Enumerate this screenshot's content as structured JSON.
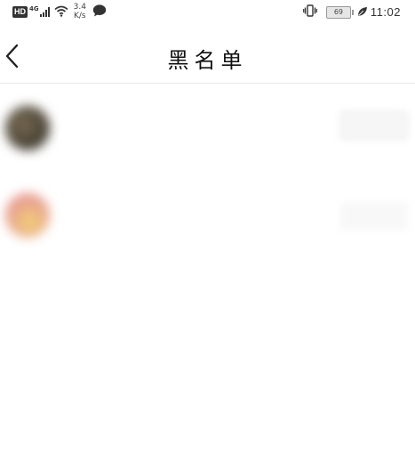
{
  "status_bar": {
    "hd_badge": "HD",
    "network_type": "4G",
    "speed_value": "3.4",
    "speed_unit": "K/s",
    "battery_level": "69",
    "time": "11:02",
    "icons": [
      "signal-icon",
      "wifi-icon",
      "chat-bubble-icon",
      "vibrate-icon",
      "battery-icon",
      "leaf-icon"
    ]
  },
  "header": {
    "title": "黑名单",
    "back_icon": "chevron-left-icon"
  },
  "blocked_list": {
    "items": [
      {
        "name": "",
        "description": "",
        "action_label": "",
        "avatar_colors": [
          "#4a4436",
          "#7a6c55"
        ]
      },
      {
        "name": "",
        "description": "",
        "action_label": "",
        "avatar_colors": [
          "#e79a92",
          "#f2d277"
        ]
      }
    ]
  },
  "colors": {
    "background": "#ffffff",
    "divider": "#e8e8e8",
    "title_text": "#111111"
  }
}
